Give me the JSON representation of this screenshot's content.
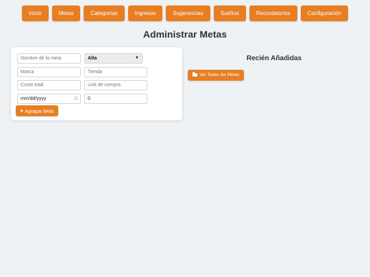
{
  "nav": {
    "items": [
      {
        "label": "Inicio"
      },
      {
        "label": "Metas"
      },
      {
        "label": "Categorías"
      },
      {
        "label": "Ingresos"
      },
      {
        "label": "Sugerencias"
      },
      {
        "label": "Sueños"
      },
      {
        "label": "Recordatorios"
      },
      {
        "label": "Configuración"
      }
    ]
  },
  "page": {
    "title": "Administrar Metas"
  },
  "form": {
    "goal_name_placeholder": "Nombre de la meta",
    "priority": {
      "selected": "Alta"
    },
    "brand_placeholder": "Marca",
    "store_placeholder": "Tienda",
    "total_cost_placeholder": "Costo total",
    "purchase_link_placeholder": "Link de compra",
    "date_placeholder": "mm/dd/yyyy",
    "quantity_value": "0",
    "add_label": "Agragar Meta"
  },
  "recent": {
    "title": "Recién Añadidas",
    "view_all_label": "Ver Todas las Metas"
  },
  "colors": {
    "accent": "#e67e22",
    "background": "#eff2f5",
    "card": "#ffffff"
  }
}
